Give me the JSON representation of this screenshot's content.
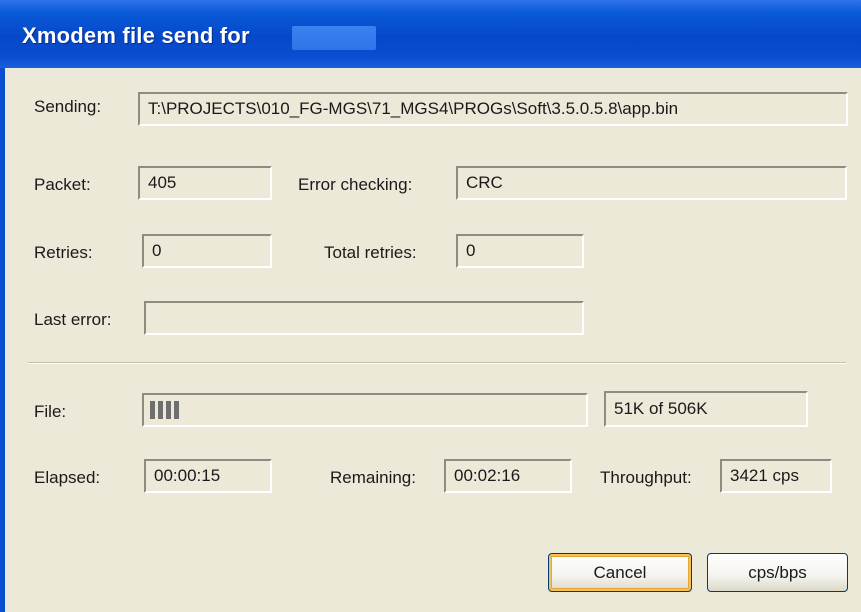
{
  "window": {
    "title": "Xmodem file send for"
  },
  "fields": {
    "sending_label": "Sending:",
    "sending_value": "T:\\PROJECTS\\010_FG-MGS\\71_MGS4\\PROGs\\Soft\\3.5.0.5.8\\app.bin",
    "packet_label": "Packet:",
    "packet_value": "405",
    "error_checking_label": "Error checking:",
    "error_checking_value": "CRC",
    "retries_label": "Retries:",
    "retries_value": "0",
    "total_retries_label": "Total retries:",
    "total_retries_value": "0",
    "last_error_label": "Last error:",
    "last_error_value": ""
  },
  "transfer": {
    "file_label": "File:",
    "file_progress_fraction": 0.1,
    "file_size_text": "51K of 506K",
    "elapsed_label": "Elapsed:",
    "elapsed_value": "00:00:15",
    "remaining_label": "Remaining:",
    "remaining_value": "00:02:16",
    "throughput_label": "Throughput:",
    "throughput_value": "3421 cps"
  },
  "buttons": {
    "cancel": "Cancel",
    "cps_bps": "cps/bps"
  },
  "colors": {
    "titlebar": "#0548c9",
    "dialog_background": "#ece9d8",
    "progress_block": "#6f6f6f"
  }
}
